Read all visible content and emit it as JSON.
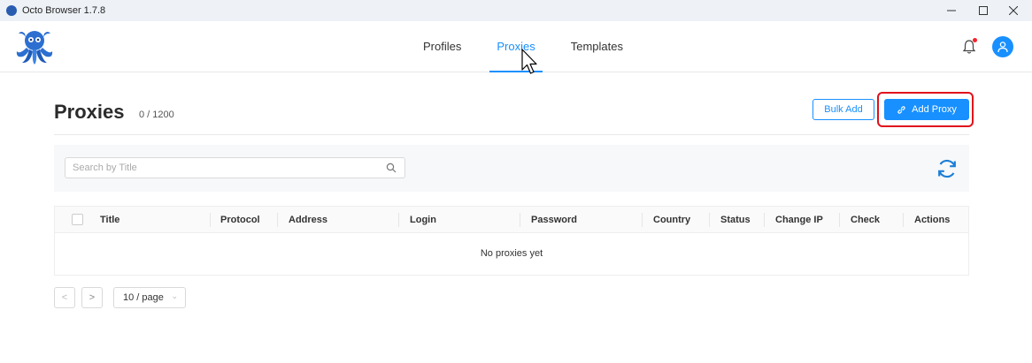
{
  "window": {
    "title": "Octo Browser 1.7.8"
  },
  "nav": {
    "items": [
      {
        "label": "Profiles"
      },
      {
        "label": "Proxies"
      },
      {
        "label": "Templates"
      }
    ]
  },
  "page": {
    "title": "Proxies",
    "count": "0 / 1200",
    "bulk_add_label": "Bulk Add",
    "add_proxy_label": "Add Proxy"
  },
  "search": {
    "placeholder": "Search by Title"
  },
  "table": {
    "columns": [
      "Title",
      "Protocol",
      "Address",
      "Login",
      "Password",
      "Country",
      "Status",
      "Change IP",
      "Check",
      "Actions"
    ],
    "empty_text": "No proxies yet"
  },
  "pagination": {
    "prev": "<",
    "next": ">",
    "page_size": "10 / page"
  },
  "colors": {
    "accent": "#1890ff",
    "highlight": "#e0101c",
    "notification": "#f5222d"
  },
  "icons": [
    "octopus-logo",
    "minimize-icon",
    "maximize-icon",
    "close-icon",
    "bell-icon",
    "user-icon",
    "link-icon",
    "search-icon",
    "refresh-icon",
    "chevron-down-icon"
  ]
}
